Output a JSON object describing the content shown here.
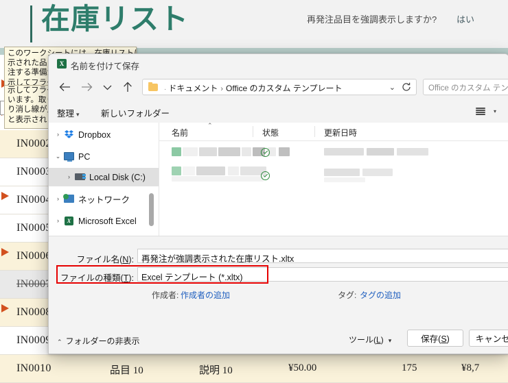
{
  "excel": {
    "title": "在庫リスト",
    "question": "再発注品目を強調表示しますか?",
    "answer": "はい",
    "comment_lines": [
      "このワークシートには、在庫リストに表",
      "示された品目が含まれています。再発",
      "注する準備ができている品目を強調表",
      "示してフラグを設定する数式が含まれて",
      "います。取り扱いが中止された品目は取",
      "り消し線が入ります。商品名の横に「取",
      "り扱い中止」と入力すると、取り消し線",
      "と表示されます。"
    ],
    "rows": [
      {
        "id": "IN0002",
        "name": "",
        "desc": "",
        "price": "",
        "qty": "",
        "total": ""
      },
      {
        "id": "IN0003",
        "name": "",
        "desc": "",
        "price": "",
        "qty": "",
        "total": ""
      },
      {
        "id": "IN0004",
        "name": "",
        "desc": "",
        "price": "",
        "qty": "",
        "total": ""
      },
      {
        "id": "IN0005",
        "name": "",
        "desc": "",
        "price": "",
        "qty": "",
        "total": ""
      },
      {
        "id": "IN0006",
        "name": "",
        "desc": "",
        "price": "",
        "qty": "",
        "total": ""
      },
      {
        "id": "IN0007",
        "name": "",
        "desc": "",
        "price": "",
        "qty": "",
        "total": ""
      },
      {
        "id": "IN0008",
        "name": "",
        "desc": "",
        "price": "",
        "qty": "",
        "total": ""
      },
      {
        "id": "IN0009",
        "name": "",
        "desc": "",
        "price": "",
        "qty": "",
        "total": ""
      },
      {
        "id": "IN0010",
        "name": "品目 10",
        "desc": "説明 10",
        "price": "¥50.00",
        "qty": "175",
        "total": "¥8,7"
      }
    ]
  },
  "dialog": {
    "title": "名前を付けて保存",
    "app_icon": "X",
    "nav": {
      "back_icon": "arrow-left-icon",
      "forward_icon": "arrow-right-icon",
      "recent_icon": "chevron-down-icon",
      "up_icon": "arrow-up-icon"
    },
    "address": {
      "folder_icon": "folder-icon",
      "separator_dot": "·",
      "crumbs": [
        "ドキュメント",
        "Office のカスタム テンプレート"
      ],
      "chevron": "⌄",
      "refresh_icon": "refresh-icon"
    },
    "search": {
      "placeholder": "Office のカスタム テンプレートの..."
    },
    "commands": {
      "organize": "整理",
      "organize_caret": "▾",
      "new_folder": "新しいフォルダー",
      "view_icon": "view-list-icon",
      "view_caret": "▾"
    },
    "tree": [
      {
        "label": "Dropbox",
        "icon": "dropbox-icon",
        "expander": "›",
        "expanded": false,
        "selected": false,
        "indent": 0
      },
      {
        "label": "PC",
        "icon": "pc-icon",
        "expander": "⌄",
        "expanded": true,
        "selected": false,
        "indent": 0
      },
      {
        "label": "Local Disk (C:)",
        "icon": "disk-icon",
        "expander": "›",
        "expanded": false,
        "selected": true,
        "indent": 1
      },
      {
        "label": "ネットワーク",
        "icon": "network-icon",
        "expander": "›",
        "expanded": false,
        "selected": false,
        "indent": 0
      },
      {
        "label": "Microsoft Excel",
        "icon": "excel-icon",
        "expander": "›",
        "expanded": false,
        "selected": false,
        "indent": 0
      }
    ],
    "columns": [
      {
        "label": "名前",
        "sorted": true,
        "sort_caret": "⌃"
      },
      {
        "label": "状態",
        "sorted": false,
        "sort_caret": ""
      },
      {
        "label": "更新日時",
        "sorted": false,
        "sort_caret": ""
      }
    ],
    "files": [
      {
        "name": "",
        "status_icon": "check-circle-icon",
        "modified": ""
      },
      {
        "name": "",
        "status_icon": "check-circle-icon",
        "modified": ""
      }
    ],
    "form": {
      "filename_label": "ファイル名(N):",
      "filename_label_accel": "N",
      "filename_value": "再発注が強調表示された在庫リスト.xltx",
      "filetype_label": "ファイルの種類(T):",
      "filetype_label_accel": "T",
      "filetype_value": "Excel テンプレート (*.xltx)",
      "author_label": "作成者:",
      "author_link": "作成者の追加",
      "tags_label": "タグ:",
      "tags_link": "タグの追加"
    },
    "footer": {
      "hide_folders": "フォルダーの非表示",
      "hide_folders_caret": "⌃",
      "tools_label": "ツール(L)",
      "tools_accel": "L",
      "tools_caret": "▾",
      "save_label": "保存(S)",
      "save_accel": "S",
      "cancel_label": "キャンセル"
    },
    "highlight_color": "#e60000"
  }
}
